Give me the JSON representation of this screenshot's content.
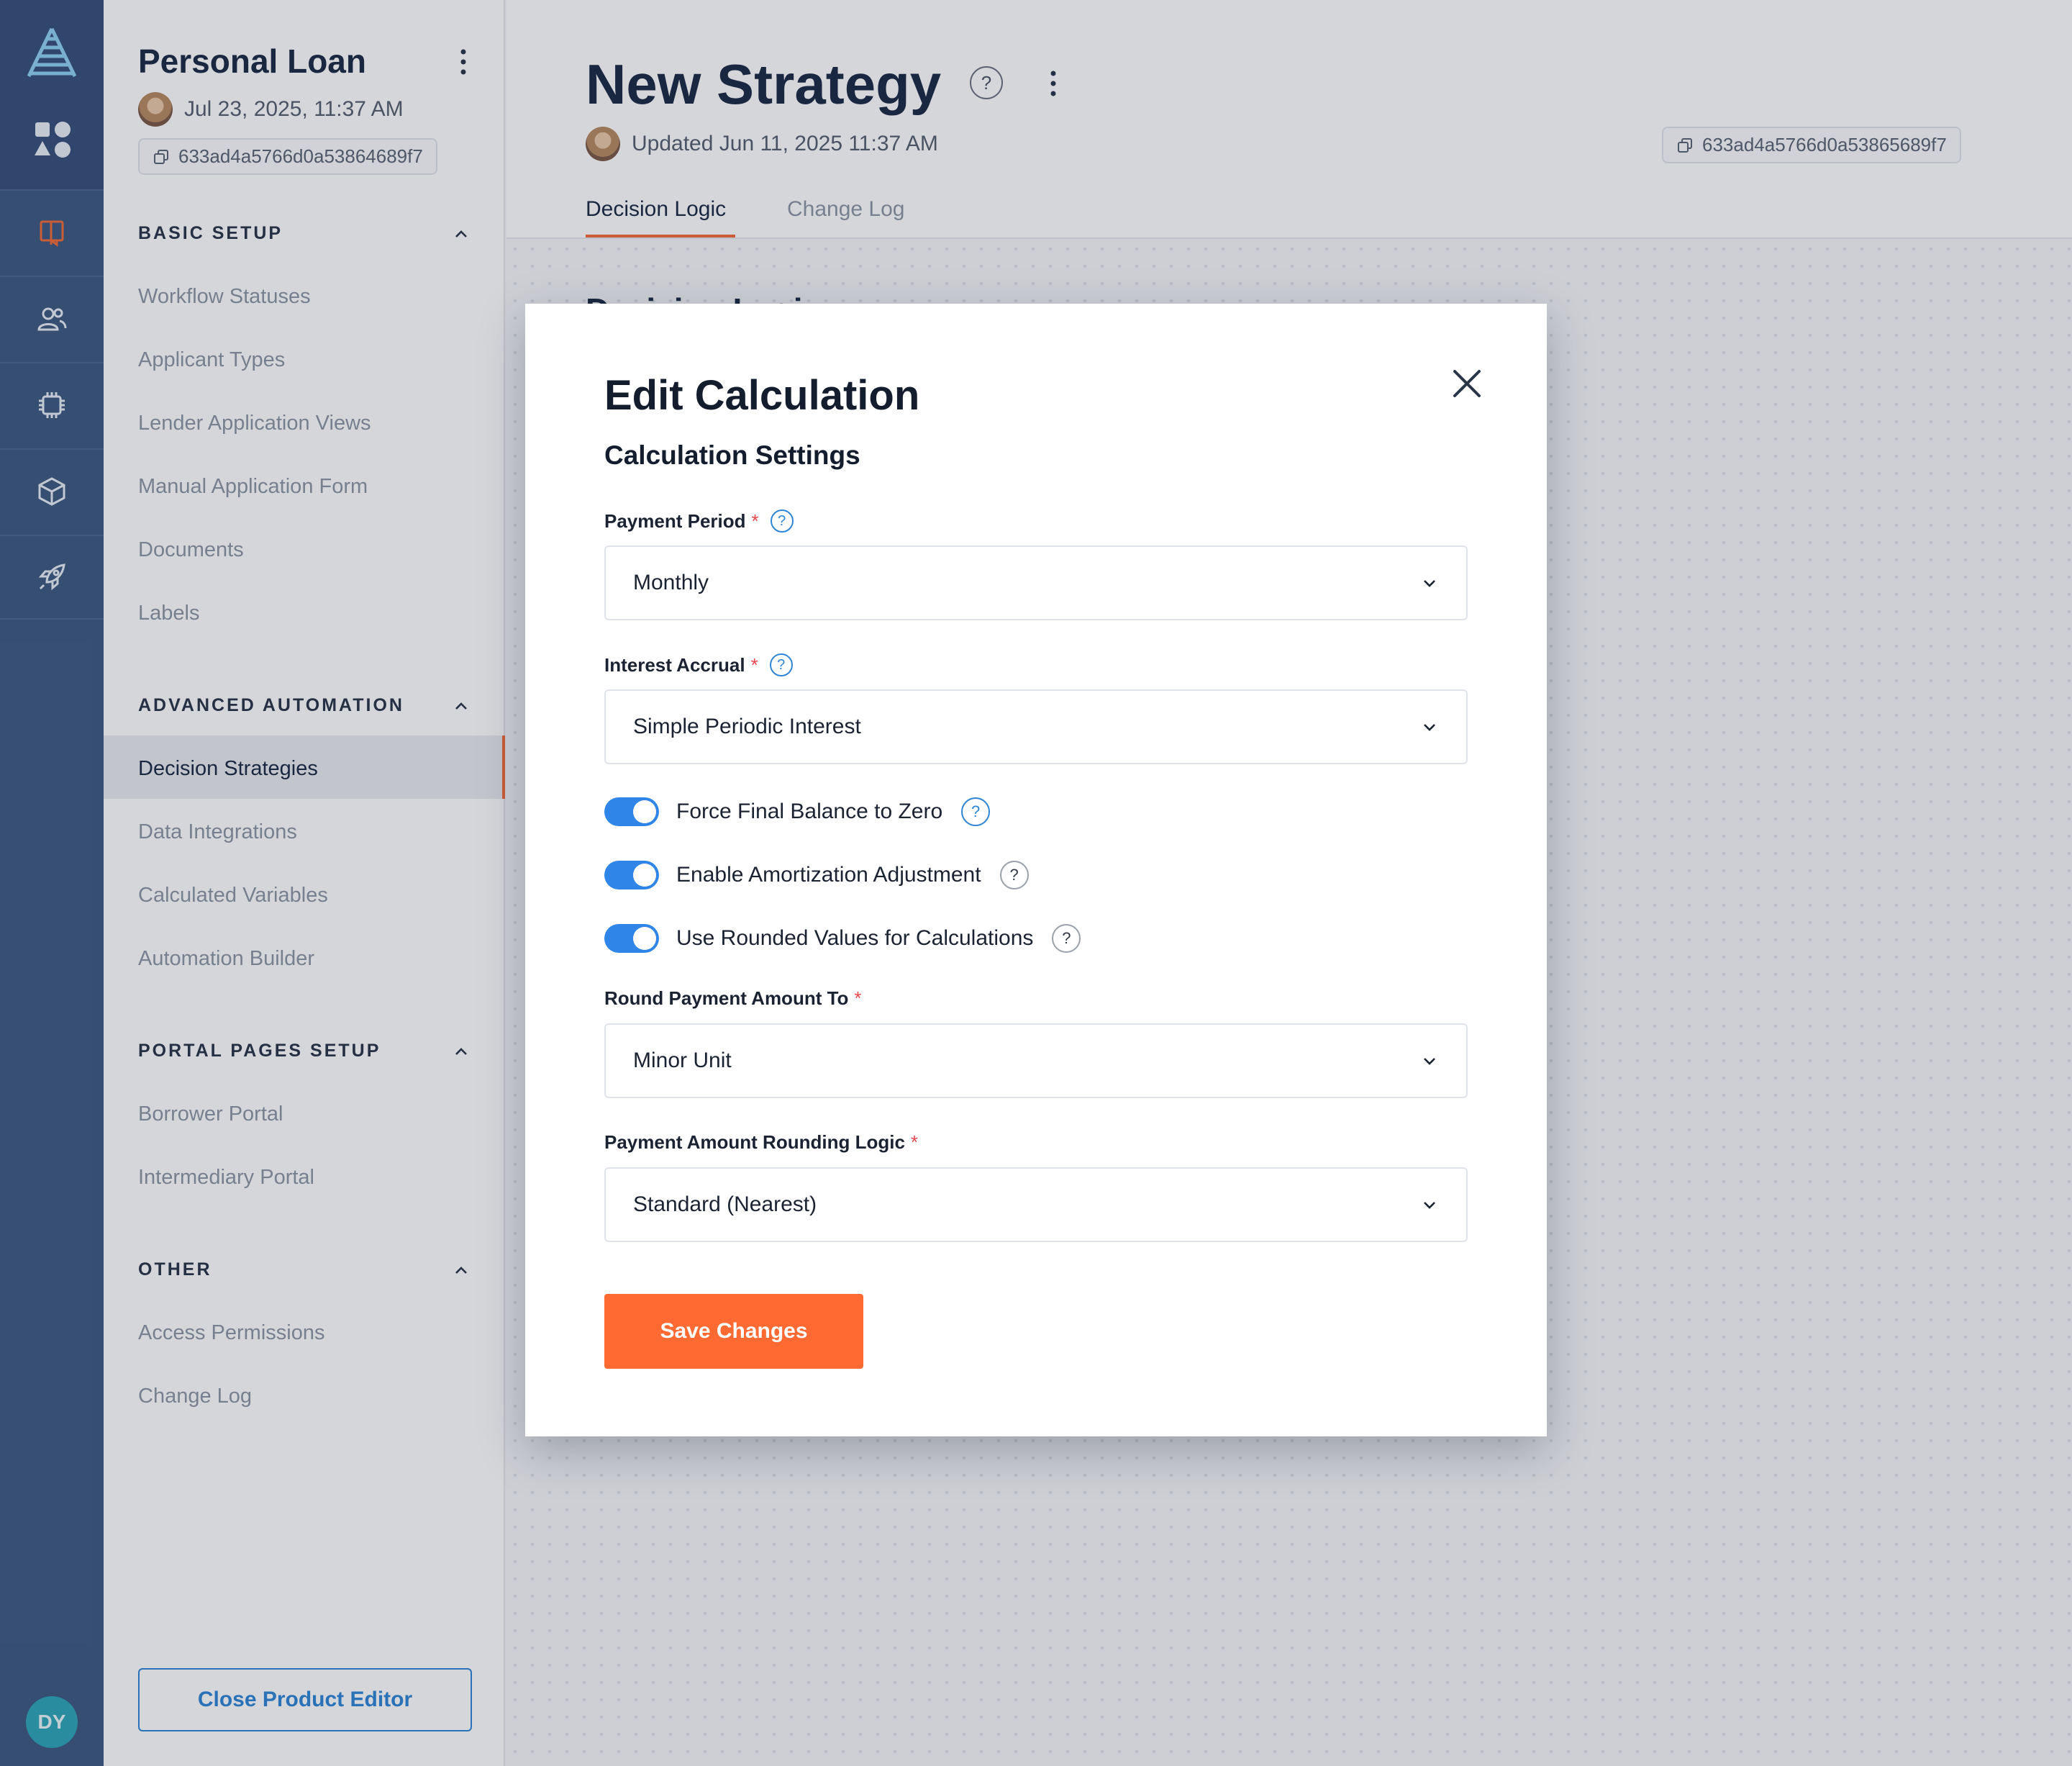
{
  "sidebar": {
    "title": "Personal Loan",
    "date": "Jul 23, 2025, 11:37 AM",
    "id": "633ad4a5766d0a53864689f7",
    "sections": [
      {
        "title": "BASIC SETUP",
        "items": [
          "Workflow Statuses",
          "Applicant Types",
          "Lender Application Views",
          "Manual Application Form",
          "Documents",
          "Labels"
        ]
      },
      {
        "title": "ADVANCED AUTOMATION",
        "items": [
          "Decision Strategies",
          "Data Integrations",
          "Calculated Variables",
          "Automation Builder"
        ]
      },
      {
        "title": "PORTAL PAGES SETUP",
        "items": [
          "Borrower Portal",
          "Intermediary Portal"
        ]
      },
      {
        "title": "OTHER",
        "items": [
          "Access Permissions",
          "Change Log"
        ]
      }
    ],
    "active_item": "Decision Strategies",
    "close_button": "Close Product Editor"
  },
  "rail": {
    "avatar_initials": "DY",
    "icons": [
      "logo-icon",
      "apps-icon",
      "book-icon",
      "users-icon",
      "chip-icon",
      "cube-icon",
      "rocket-icon"
    ],
    "active_color": "#f26b3a"
  },
  "header": {
    "title": "New Strategy",
    "help": "?",
    "updated": "Updated Jun 11, 2025 11:37 AM",
    "id": "633ad4a5766d0a53865689f7",
    "tabs": [
      "Decision Logic",
      "Change Log"
    ],
    "active_tab": "Decision Logic",
    "section_heading_peek": "Decision Logic"
  },
  "modal": {
    "title": "Edit Calculation",
    "subtitle": "Calculation Settings",
    "fields": {
      "payment_period": {
        "label": "Payment Period",
        "value": "Monthly"
      },
      "interest_accrual": {
        "label": "Interest Accrual",
        "value": "Simple Periodic Interest"
      },
      "round_payment": {
        "label": "Round Payment Amount To",
        "value": "Minor Unit"
      },
      "rounding_logic": {
        "label": "Payment Amount Rounding Logic",
        "value": "Standard (Nearest)"
      }
    },
    "required_marker": "*",
    "help_marker": "?",
    "toggles": [
      {
        "label": "Force Final Balance to Zero",
        "on": true
      },
      {
        "label": "Enable Amortization Adjustment",
        "on": true
      },
      {
        "label": "Use Rounded Values for Calculations",
        "on": true
      }
    ],
    "save_label": "Save Changes"
  },
  "colors": {
    "accent": "#ff6a33",
    "primary_blue": "#2f86e8",
    "rail": "#3e5a80"
  }
}
